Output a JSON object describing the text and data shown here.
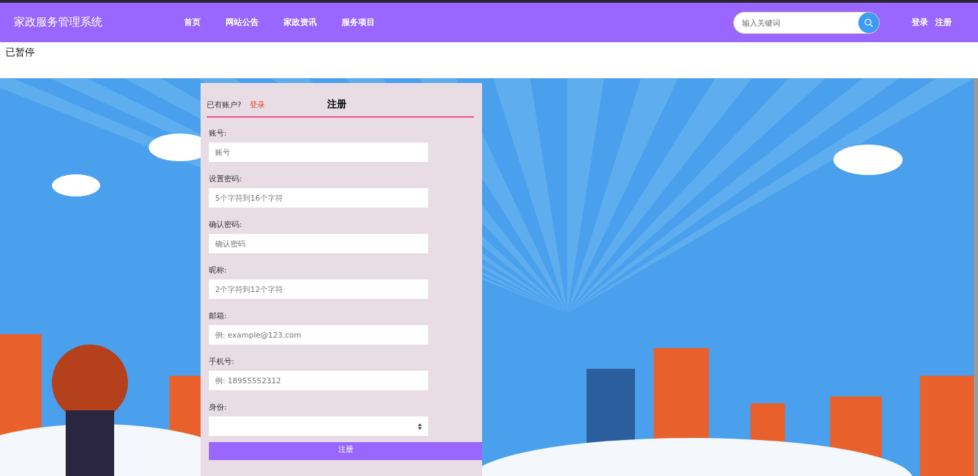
{
  "header": {
    "site_title": "家政服务管理系统",
    "nav": [
      {
        "label": "首页"
      },
      {
        "label": "网站公告"
      },
      {
        "label": "家政资讯"
      },
      {
        "label": "服务项目"
      }
    ],
    "search": {
      "placeholder": "输入关键词"
    },
    "account_links": [
      {
        "label": "登录"
      },
      {
        "label": "注册"
      }
    ]
  },
  "status_text": "已暂停",
  "register_form": {
    "prompt": "已有账户?",
    "login_link": "登录",
    "title": "注册",
    "fields": [
      {
        "kind": "input",
        "label": "账号:",
        "placeholder": "账号"
      },
      {
        "kind": "input",
        "label": "设置密码:",
        "placeholder": "5个字符到16个字符"
      },
      {
        "kind": "input",
        "label": "确认密码:",
        "placeholder": "确认密码"
      },
      {
        "kind": "input",
        "label": "昵称:",
        "placeholder": "2个字符到12个字符"
      },
      {
        "kind": "input",
        "label": "邮箱:",
        "placeholder": "例: example@123.com"
      },
      {
        "kind": "input",
        "label": "手机号:",
        "placeholder": "例: 18955552312"
      },
      {
        "kind": "select",
        "label": "身份:"
      }
    ],
    "submit": "注册"
  }
}
